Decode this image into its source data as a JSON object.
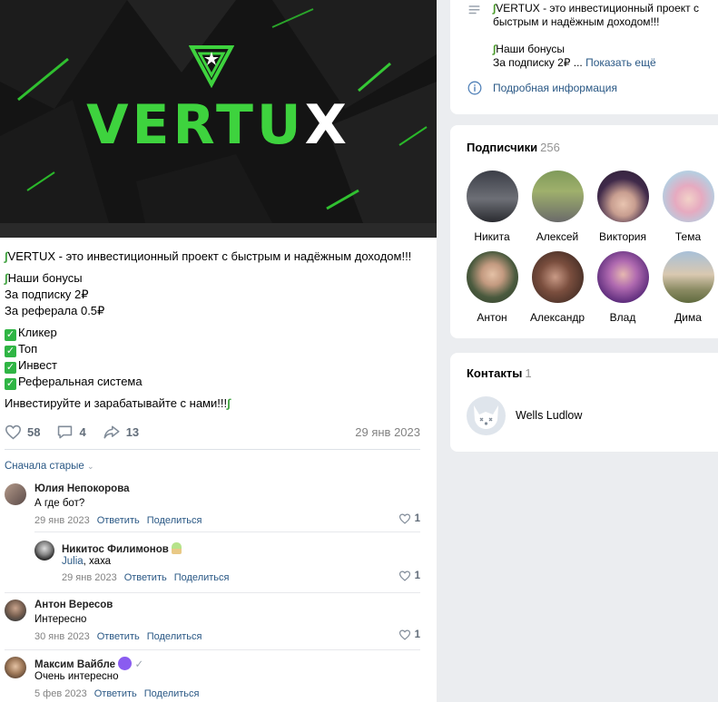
{
  "post": {
    "banner_logo_main": "VERTU",
    "banner_logo_x": "X",
    "intro": "VERTUX - это инвестиционный проект с быстрым и надёжным доходом!!!",
    "bonus_title": "Наши бонусы",
    "bonus_sub": "За подписку 2₽",
    "bonus_ref": "За реферала 0.5₽",
    "features": [
      "Кликер",
      "Топ",
      "Инвест",
      "Реферальная система"
    ],
    "cta": "Инвестируйте и зарабатывайте с нами!!!",
    "likes": "58",
    "comments": "4",
    "shares": "13",
    "date": "29 янв 2023"
  },
  "sort_label": "Сначала старые",
  "comments": [
    {
      "name": "Юлия Непокорова",
      "text": "А где бот?",
      "date": "29 янв 2023",
      "reply": "Ответить",
      "share": "Поделиться",
      "likes": "1"
    },
    {
      "name": "Никитос Филимонов",
      "mention": "Julia",
      "text": ", хаха",
      "date": "29 янв 2023",
      "reply": "Ответить",
      "share": "Поделиться",
      "likes": "1"
    },
    {
      "name": "Антон Вересов",
      "text": "Интересно",
      "date": "30 янв 2023",
      "reply": "Ответить",
      "share": "Поделиться",
      "likes": "1"
    },
    {
      "name": "Максим Вайбле",
      "text": "Очень интересно",
      "date": "5 фев 2023",
      "reply": "Ответить",
      "share": "Поделиться"
    }
  ],
  "info": {
    "line1": "VERTUX - это инвестиционный проект с",
    "line2": "быстрым и надёжным доходом!!!",
    "line3": "Наши бонусы",
    "line4": "За подписку 2₽ ...",
    "more": "Показать ещё",
    "details_link": "Подробная информация"
  },
  "subscribers": {
    "title": "Подписчики",
    "count": "256",
    "people": [
      "Никита",
      "Алексей",
      "Виктория",
      "Тема",
      "Антон",
      "Александр",
      "Влад",
      "Дима"
    ]
  },
  "contacts": {
    "title": "Контакты",
    "count": "1",
    "name": "Wells Ludlow"
  },
  "colors": {
    "accent_green": "#3ed33e",
    "link": "#2a5885",
    "page_bg": "#ebedf0"
  }
}
